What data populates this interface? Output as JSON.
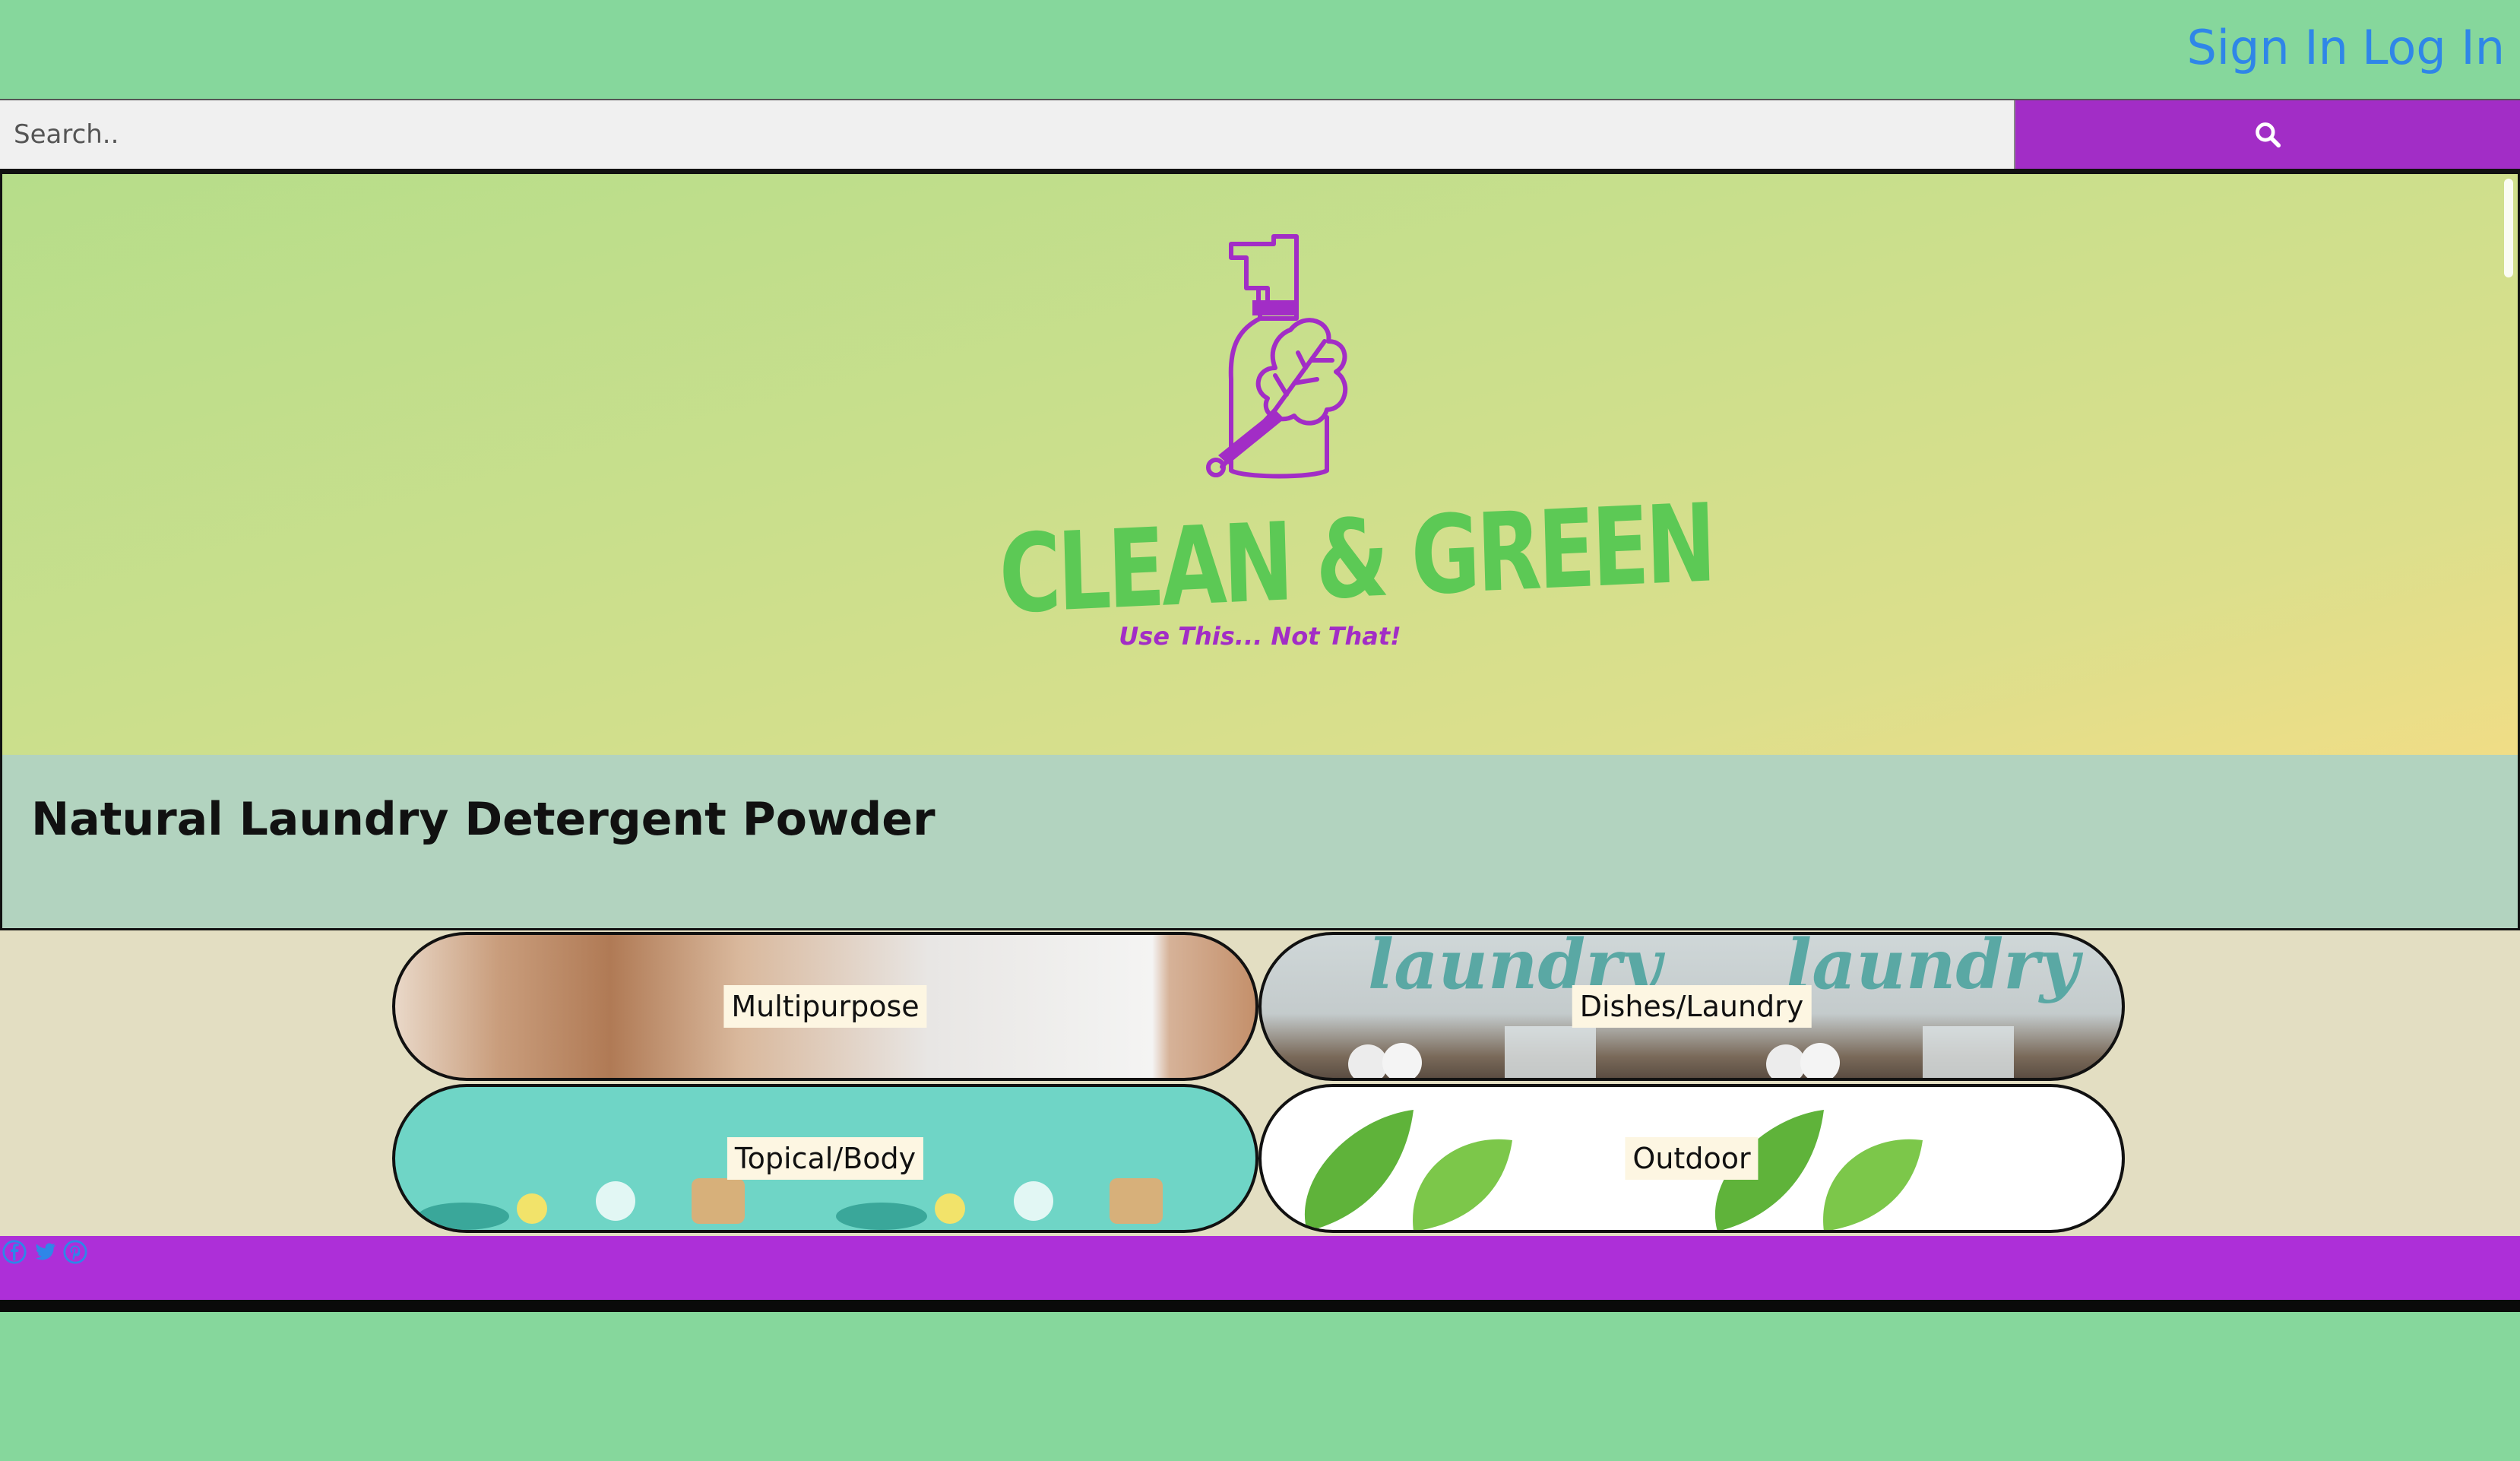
{
  "header": {
    "sign_in_label": "Sign In",
    "log_in_label": "Log In"
  },
  "search": {
    "placeholder": "Search..",
    "button_icon": "search-icon"
  },
  "hero": {
    "brand_name": "CLEAN & GREEN",
    "tagline": "Use This... Not That!",
    "logo_icon": "spray-bottle-leaf-icon"
  },
  "product": {
    "title": "Natural Laundry Detergent Powder"
  },
  "categories": [
    {
      "label": "Multipurpose"
    },
    {
      "label": "Dishes/Laundry"
    },
    {
      "label": "Topical/Body"
    },
    {
      "label": "Outdoor"
    }
  ],
  "footer": {
    "social": [
      "facebook-icon",
      "twitter-icon",
      "pinterest-icon"
    ]
  },
  "colors": {
    "page_bg": "#86d79c",
    "link": "#2f86e8",
    "accent_purple": "#a22dc6",
    "brand_green": "#5cc955",
    "footer_purple": "#ad2fd8",
    "product_strip": "#b2d3bf",
    "category_bg": "#e3dec2"
  }
}
